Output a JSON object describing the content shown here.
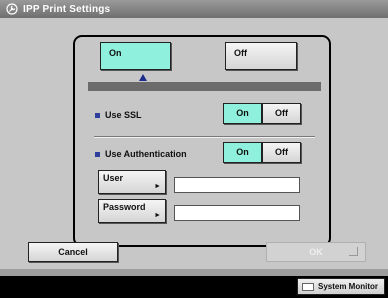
{
  "title": "IPP Print Settings",
  "icons": {
    "title": "settings-wrench-icon",
    "bullet": "square-bullet-icon",
    "arrow": "arrow-right-icon",
    "enter": "enter-icon",
    "monitor": "monitor-icon"
  },
  "mode": {
    "on_label": "On",
    "off_label": "Off",
    "selected": "On"
  },
  "ssl": {
    "label": "Use SSL",
    "on_label": "On",
    "off_label": "Off",
    "selected": "On"
  },
  "auth": {
    "label": "Use Authentication",
    "on_label": "On",
    "off_label": "Off",
    "selected": "On"
  },
  "user": {
    "button_label": "User",
    "value": ""
  },
  "password": {
    "button_label": "Password",
    "value": ""
  },
  "buttons": {
    "cancel": "Cancel",
    "ok": "OK"
  },
  "status_bar": {
    "system_monitor": "System Monitor"
  },
  "colors": {
    "selected": "#8ff0dd",
    "accent_blue": "#2c3f9c",
    "panel": "#c7c7c7"
  }
}
